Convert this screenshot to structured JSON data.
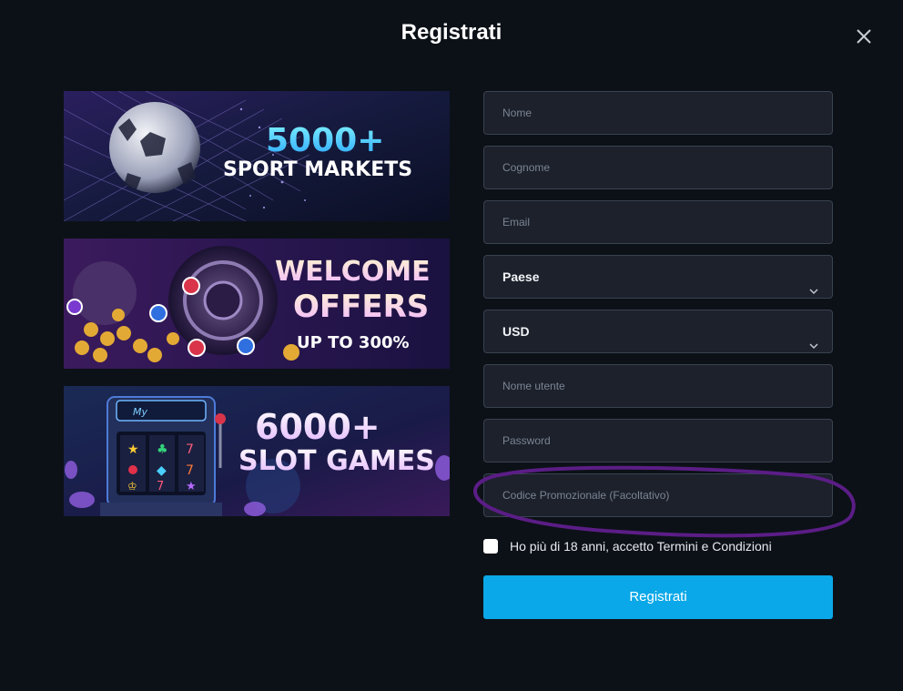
{
  "modal": {
    "title": "Registrati"
  },
  "banners": [
    {
      "line1": "5000+",
      "line2": "SPORT MARKETS"
    },
    {
      "line1": "WELCOME",
      "line2": "OFFERS",
      "line3": "UP TO 300%"
    },
    {
      "line1": "6000+",
      "line2": "SLOT GAMES"
    }
  ],
  "form": {
    "first_name": "Nome",
    "last_name": "Cognome",
    "email": "Email",
    "country": "Paese",
    "currency": "USD",
    "username": "Nome utente",
    "password": "Password",
    "promo_code": "Codice Promozionale (Facoltativo)",
    "terms_label": "Ho più di 18 anni, accetto Termini e Condizioni",
    "terms_checked": false,
    "submit_label": "Registrati"
  },
  "colors": {
    "background": "#0c1117",
    "field_bg": "#1c212b",
    "field_border": "#394250",
    "primary_button": "#0aa8e8",
    "annotation": "#5b1d86"
  },
  "icons": {
    "close": "close-icon",
    "dropdown": "chevron-down-icon"
  }
}
